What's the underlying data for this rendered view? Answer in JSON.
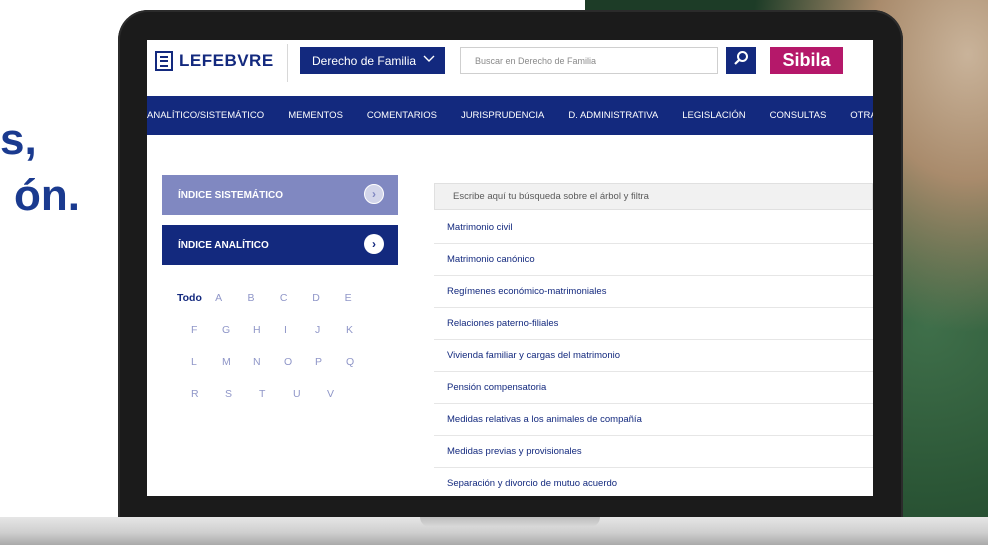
{
  "tagline": {
    "line1": "s,",
    "line2": "ón."
  },
  "header": {
    "logo_text": "LEFEBVRE",
    "product": "Derecho de Familia",
    "search_placeholder": "Buscar en Derecho de Familia",
    "sibila": "Sibila"
  },
  "nav": {
    "items": [
      {
        "label": "ANALÍTICO/SISTEMÁTICO"
      },
      {
        "label": "MEMENTOS"
      },
      {
        "label": "COMENTARIOS"
      },
      {
        "label": "JURISPRUDENCIA"
      },
      {
        "label": "D. ADMINISTRATIVA"
      },
      {
        "label": "LEGISLACIÓN"
      },
      {
        "label": "CONSULTAS"
      },
      {
        "label": "OTRA DO"
      }
    ]
  },
  "left": {
    "indice_sistematico": "ÍNDICE SISTEMÁTICO",
    "indice_analitico": "ÍNDICE ANALÍTICO",
    "alphabet": [
      [
        "Todo",
        "A",
        "B",
        "C",
        "D",
        "E"
      ],
      [
        "F",
        "G",
        "H",
        "I",
        "J",
        "K"
      ],
      [
        "L",
        "M",
        "N",
        "O",
        "P",
        "Q"
      ],
      [
        "R",
        "S",
        "T",
        "U",
        "V"
      ]
    ]
  },
  "right": {
    "filter_placeholder": "Escribe aquí tu búsqueda sobre el árbol y filtra",
    "items": [
      "Matrimonio civil",
      "Matrimonio canónico",
      "Regímenes económico-matrimoniales",
      "Relaciones paterno-filiales",
      "Vivienda familiar y cargas del matrimonio",
      "Pensión compensatoria",
      "Medidas relativas a los animales de compañía",
      "Medidas previas y provisionales",
      "Separación y divorcio de mutuo acuerdo"
    ]
  },
  "colors": {
    "brand": "#13297e",
    "sibila": "#b5186a",
    "index_light": "#8088c1"
  }
}
